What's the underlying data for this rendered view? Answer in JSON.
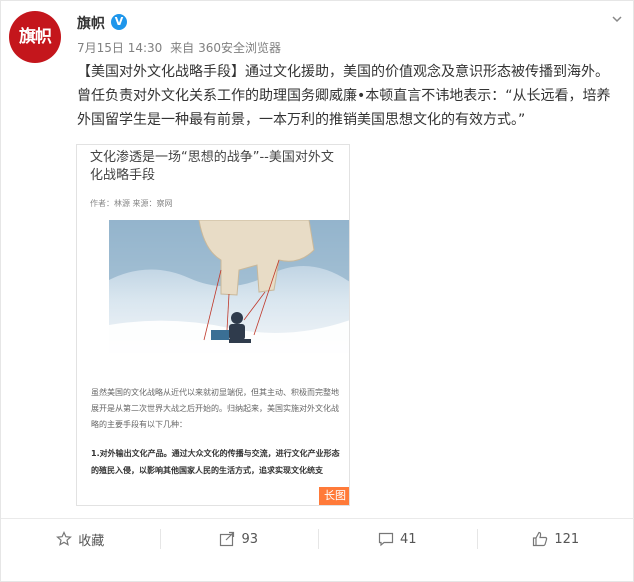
{
  "post": {
    "username": "旗帜",
    "vip_badge": "V",
    "avatar_text": "旗帜",
    "date": "7月15日 14:30",
    "source_prefix": "来自",
    "source": "360安全浏览器",
    "text_tag": "【美国对外文化战略手段】",
    "text_body": "通过文化援助，美国的价值观念及意识形态被传播到海外。曾任负责对外文化关系工作的助理国务卿威廉•本顿直言不讳地表示：“从长远看，培养外国留学生是一种最有前景，一本万利的推销美国思想文化的有效方式。”"
  },
  "article": {
    "title": "文化渗透是一场“思想的战争”--美国对外文化战略手段",
    "byline": "作者：林源 来源：察网",
    "paragraph": "虽然美国的文化战略从近代以来就初显端倪，但其主动、积极而完整地展开是从第二次世界大战之后开始的。归纳起来，美国实施对外文化战略的主要手段有以下几种：",
    "bold_point": "1.对外输出文化产品。通过大众文化的传播与交流，进行文化产业形态的殖民入侵，以影响其他国家人民的生活方式，追求实现文化统支",
    "long_badge": "长图"
  },
  "actions": {
    "favorite": "收藏",
    "repost": "93",
    "comment": "41",
    "like": "121"
  }
}
